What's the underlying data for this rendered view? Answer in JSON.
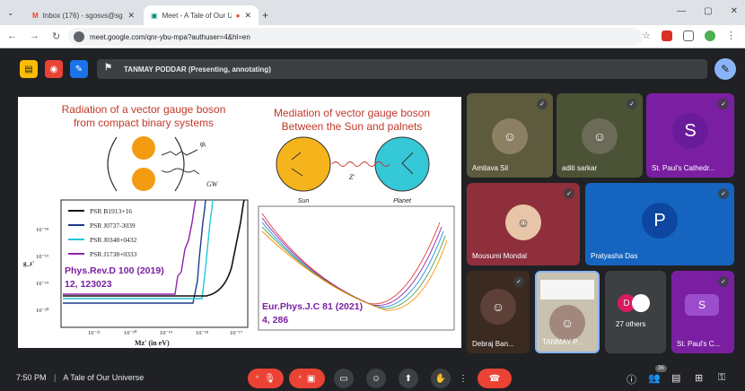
{
  "browser": {
    "tabs": [
      {
        "label": "Inbox (176) - sgosvs@sgsv.ac",
        "active": false
      },
      {
        "label": "Meet - A Tale of Our Univer",
        "active": true
      }
    ],
    "url": "meet.google.com/qnr-ybu-mpa?authuser=4&hl=en"
  },
  "meet": {
    "presenter_label": "TANMAY PODDAR (Presenting, annotating)",
    "time": "7:50 PM",
    "separator": "|",
    "meeting_title": "A Tale of Our Universe",
    "participants_badge": "36",
    "accent": "#ea4335"
  },
  "slide": {
    "left_title_1": "Radiation of a vector gauge boson",
    "left_title_2": "from compact binary systems",
    "right_title_1": "Mediation of vector gauge boson",
    "right_title_2": "Between the Sun and palnets",
    "phi_label": "φᵢ",
    "gw_label": "GW",
    "sun_label": "Sun",
    "planet_label": "Planet",
    "z_label": "Z'",
    "legend": [
      "PSR B1913+16",
      "PSR J0737-3039",
      "PSR J0348+0432",
      "PSR J1738+0333"
    ],
    "ref1_line1": "Phys.Rev.D 100 (2019)",
    "ref1_line2": "12, 123023",
    "ref2_line1": "Eur.Phys.J.C 81 (2021)",
    "ref2_line2": "4, 286",
    "x_axis_label": "Mz' (in eV)",
    "y_axis_label": "g_z'",
    "y_ticks": [
      "10⁻¹⁸",
      "10⁻¹⁹",
      "10⁻¹⁹",
      "10⁻²⁰"
    ],
    "x_ticks": [
      "10⁻²¹",
      "10⁻²⁰",
      "10⁻¹⁹",
      "10⁻¹⁸",
      "10⁻¹⁷"
    ]
  },
  "tiles": [
    {
      "name": "Amitava Sil"
    },
    {
      "name": "aditi sarkar"
    },
    {
      "name": "St. Paul's Cathedr...",
      "letter": "S"
    },
    {
      "name": "Mousumi Mondal"
    },
    {
      "name": "Pratyasha Das",
      "letter": "P"
    },
    {
      "name": "Debraj Ban..."
    },
    {
      "name": "TANMAY P..."
    },
    {
      "name": "27 others",
      "letter": "D"
    },
    {
      "name": "St. Paul's C...",
      "letter": "S"
    }
  ]
}
